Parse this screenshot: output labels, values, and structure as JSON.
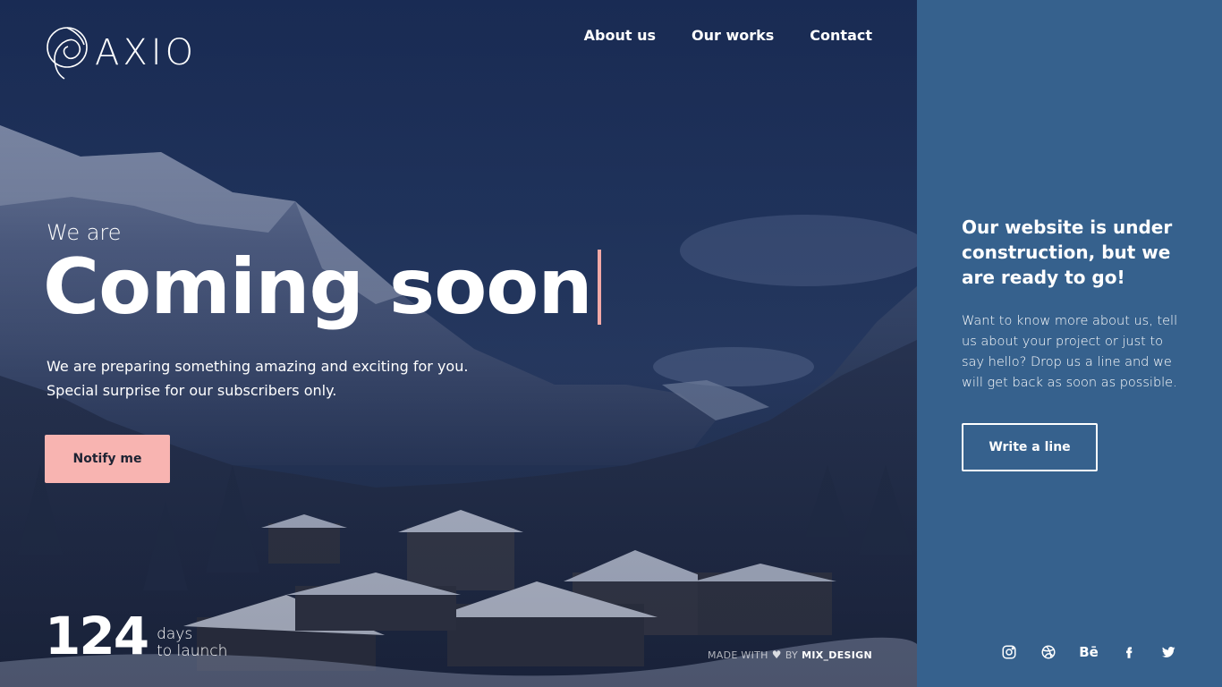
{
  "brand": {
    "name": "AXIO"
  },
  "nav": {
    "items": [
      "About us",
      "Our works",
      "Contact"
    ]
  },
  "hero": {
    "eyebrow": "We are",
    "headline": "Coming soon",
    "subtitle_lines": [
      "We are preparing something amazing and exciting for you.",
      "Special surprise for our subscribers only."
    ],
    "cta_label": "Notify me",
    "accent_color": "#f8b4b1"
  },
  "countdown": {
    "value": "124",
    "unit": "days",
    "caption": "to launch"
  },
  "footer": {
    "made_with": "MADE WITH",
    "by": "BY",
    "author": "MIX_DESIGN"
  },
  "panel": {
    "title": "Our website is under construction, but we are ready to go!",
    "text": "Want to know more about us, tell us about your project or just to say hello? Drop us a line and we will get back as soon as possible.",
    "button_label": "Write a line",
    "background_color": "#36618d"
  },
  "social": {
    "icons": [
      "instagram-icon",
      "dribbble-icon",
      "behance-icon",
      "facebook-icon",
      "twitter-icon"
    ],
    "behance_glyph": "Bē"
  }
}
